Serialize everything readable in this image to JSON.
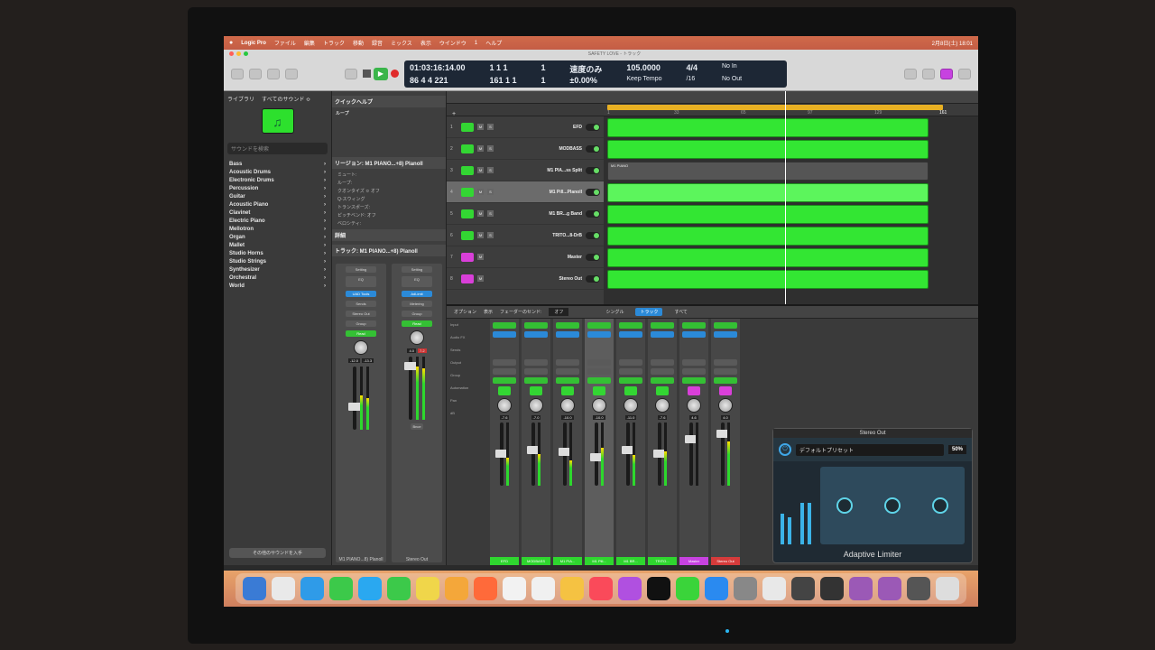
{
  "menubar": {
    "apple": "",
    "items": [
      "Logic Pro",
      "ファイル",
      "編集",
      "トラック",
      "移動",
      "録音",
      "ミックス",
      "表示",
      "ウインドウ",
      "1",
      "ヘルプ"
    ],
    "clock": "2月8日(土) 18:01"
  },
  "window": {
    "title": "SAFETY LOVE - トラック"
  },
  "transport": {
    "position_time": "01:03:16:14.00",
    "position_bars": "86 4 4 221",
    "bars_a": "1 1 1",
    "bars_a2": "1",
    "bars_b": "161 1 1",
    "bars_b2": "1",
    "tempo_mode": "速度のみ",
    "tempo_mode2": "±0.00%",
    "tempo": "105.0000",
    "keep_tempo": "Keep Tempo",
    "time_sig": "4/4",
    "division": "/16",
    "no_in": "No In",
    "no_out": "No Out"
  },
  "library": {
    "tab1": "ライブラリ",
    "tab2": "すべてのサウンド ≎",
    "icon": "♫",
    "search": "サウンドを検索",
    "items": [
      "Bass",
      "Acoustic Drums",
      "Electronic Drums",
      "Percussion",
      "Guitar",
      "Acoustic Piano",
      "Clavinet",
      "Electric Piano",
      "Mellotron",
      "Organ",
      "Mallet",
      "Studio Horns",
      "Studio Strings",
      "Synthesizer",
      "Orchestral",
      "World"
    ],
    "footer": "その他のサウンドを入手"
  },
  "inspector": {
    "quick_help": "クイックヘルプ",
    "help_title": "ループ",
    "help_text": "",
    "region_header": "リージョン: M1 PIANO...+8) Planoll",
    "mute": "ミュート:",
    "loop": "ループ:",
    "quantize": "クオンタイズ ≎ オフ",
    "q_swing": "Q-スウィング",
    "transpose": "トランスポーズ:",
    "velocity": "ベロシティ:",
    "velocity_hint": "ピッチベンド: オフ",
    "more": "詳細",
    "track_header": "トラック: M1 PIANO...+8) Planoll",
    "strip1": {
      "setting": "Setting",
      "eq": "EQ",
      "plugin": "UAD Tools",
      "sends": "Sends",
      "output": "Stereo Out",
      "group": "Group",
      "auto": "Read",
      "vol": "-12.0",
      "vol2": "-13.3",
      "name": "M1 PIANO...8) Planoll"
    },
    "strip2": {
      "setting": "Setting",
      "eq": "EQ",
      "plugin": "AdLimit",
      "metering": "Metering",
      "group": "Group",
      "auto": "Read",
      "vol": "4.0",
      "vol2": "7.2",
      "name": "Stereo Out",
      "bnce": "Bnce"
    }
  },
  "tracks": [
    {
      "num": "1",
      "name": "EFD",
      "color": "green"
    },
    {
      "num": "2",
      "name": "MODBASS",
      "color": "green"
    },
    {
      "num": "3",
      "name": "M1 PIA...ss Split",
      "color": "green"
    },
    {
      "num": "4",
      "name": "M1 Pill...Planoll",
      "color": "green"
    },
    {
      "num": "5",
      "name": "M1 BR...g Band",
      "color": "green"
    },
    {
      "num": "6",
      "name": "TRITO...8-DrB",
      "color": "green"
    },
    {
      "num": "7",
      "name": "Master",
      "color": "pink"
    },
    {
      "num": "8",
      "name": "Stereo Out",
      "color": "pink"
    }
  ],
  "ruler": [
    "1",
    "33",
    "65",
    "97",
    "129",
    "161"
  ],
  "region_label": "M1 PIANO",
  "mixer": {
    "send_mode": "フェーダーのセンド:",
    "send_value": "オフ",
    "options": "オプション",
    "view": "表示",
    "tabs": [
      "シングル",
      "トラック",
      "すべて"
    ],
    "row_labels": [
      "Input",
      "Audio FX",
      "Sends",
      "Output",
      "Group",
      "Automation",
      "Pan",
      "dB"
    ],
    "strips": [
      {
        "vol": "-7.6",
        "name": "EFD",
        "color": "green"
      },
      {
        "vol": "-7.0",
        "name": "MODBASS",
        "color": "green"
      },
      {
        "vol": "-10.0",
        "name": "M1 PIA...",
        "color": "green"
      },
      {
        "vol": "-10.0",
        "name": "M1 Pill...",
        "color": "green"
      },
      {
        "vol": "-11.0",
        "name": "M1 BR...",
        "color": "green"
      },
      {
        "vol": "-7.6",
        "name": "TRITO...",
        "color": "green"
      },
      {
        "vol": "4.6",
        "name": "Master",
        "color": "pink"
      },
      {
        "vol": "4.0",
        "name": "Stereo Out",
        "color": "red"
      }
    ]
  },
  "plugin": {
    "window_title": "Stereo Out",
    "power": "⏻",
    "preset": "デフォルトプリセット",
    "percent": "50%",
    "name": "Adaptive Limiter"
  }
}
